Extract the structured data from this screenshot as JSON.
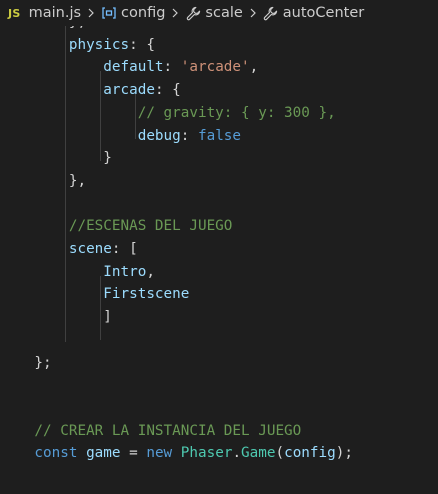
{
  "breadcrumb": {
    "file_badge": "JS",
    "file_name": "main.js",
    "crumbs": [
      "config",
      "scale",
      "autoCenter"
    ],
    "icons": [
      "variable-bracket-icon",
      "wrench-icon",
      "wrench-icon"
    ]
  },
  "editor": {
    "language": "javascript",
    "lines": [
      [
        [
          "pun",
          "        },"
        ]
      ],
      [
        [
          "prop",
          "        physics"
        ],
        [
          "pun",
          ": {"
        ]
      ],
      [
        [
          "prop",
          "            default"
        ],
        [
          "pun",
          ": "
        ],
        [
          "str",
          "'arcade'"
        ],
        [
          "pun",
          ","
        ]
      ],
      [
        [
          "prop",
          "            arcade"
        ],
        [
          "pun",
          ": {"
        ]
      ],
      [
        [
          "cmt",
          "                // gravity: { y: 300 },"
        ]
      ],
      [
        [
          "prop",
          "                debug"
        ],
        [
          "pun",
          ": "
        ],
        [
          "kw",
          "false"
        ]
      ],
      [
        [
          "pun",
          "            }"
        ]
      ],
      [
        [
          "pun",
          "        },"
        ]
      ],
      [],
      [
        [
          "cmt",
          "        //ESCENAS DEL JUEGO"
        ]
      ],
      [
        [
          "prop",
          "        scene"
        ],
        [
          "pun",
          ": ["
        ]
      ],
      [
        [
          "prop",
          "            Intro"
        ],
        [
          "pun",
          ","
        ]
      ],
      [
        [
          "prop",
          "            Firstscene"
        ]
      ],
      [
        [
          "pun",
          "            ]"
        ]
      ],
      [],
      [
        [
          "pun",
          "    };"
        ]
      ],
      [],
      [],
      [
        [
          "cmt",
          "    // CREAR LA INSTANCIA DEL JUEGO"
        ]
      ],
      [
        [
          "kw",
          "    const"
        ],
        [
          "pun",
          " "
        ],
        [
          "prop",
          "game"
        ],
        [
          "pun",
          " = "
        ],
        [
          "kw",
          "new"
        ],
        [
          "pun",
          " "
        ],
        [
          "cls",
          "Phaser"
        ],
        [
          "pun",
          "."
        ],
        [
          "cls",
          "Game"
        ],
        [
          "pun",
          "("
        ],
        [
          "prop",
          "config"
        ],
        [
          "pun",
          ");"
        ]
      ]
    ]
  },
  "colors": {
    "background": "#1e1e1e",
    "text": "#d4d4d4",
    "keyword": "#569cd6",
    "property": "#9cdcfe",
    "string": "#ce9178",
    "comment": "#6a9955",
    "class": "#4ec9b0",
    "js_badge": "#cbcb41",
    "symbol_icon": "#75beff"
  }
}
